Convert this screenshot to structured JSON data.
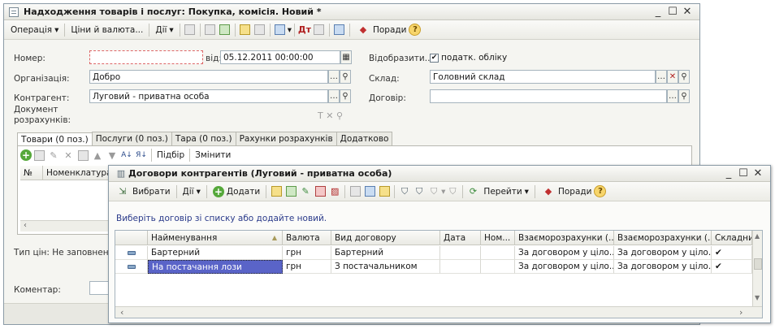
{
  "main_window": {
    "title": "Надходження товарів і послуг: Покупка, комісія. Новий *",
    "controls": [
      "_",
      "☐",
      "✕"
    ],
    "toolbar": {
      "operation": "Операція",
      "prices": "Ціни й валюта...",
      "actions": "Дії",
      "tips": "Поради"
    },
    "form": {
      "number_label": "Номер:",
      "number_value": "",
      "date_label": "від:",
      "date_value": "05.12.2011 00:00:00",
      "display_label": "Відобразити...",
      "tax_checkbox_label": "податк. обліку",
      "tax_checked": true,
      "org_label": "Організація:",
      "org_value": "Добро",
      "warehouse_label": "Склад:",
      "warehouse_value": "Головний склад",
      "contractor_label": "Контрагент:",
      "contractor_value": "Луговий - приватна особа",
      "contract_label": "Договір:",
      "contract_value": "",
      "settlement_doc_label_1": "Документ",
      "settlement_doc_label_2": "розрахунків:",
      "price_type_label": "Тип цін: Не заповнено",
      "comment_label": "Коментар:"
    },
    "tabs": [
      "Товари (0 поз.)",
      "Послуги (0 поз.)",
      "Тара (0 поз.)",
      "Рахунки розрахунків",
      "Додатково"
    ],
    "goods_toolbar": {
      "selection": "Підбір",
      "change": "Змінити"
    },
    "goods_columns": [
      "№",
      "Номенклатура"
    ]
  },
  "dialog": {
    "title": "Договори контрагентів (Луговий - приватна особа)",
    "controls": [
      "_",
      "☐",
      "✕"
    ],
    "toolbar": {
      "select": "Вибрати",
      "actions": "Дії",
      "add": "Додати",
      "go": "Перейти",
      "tips": "Поради"
    },
    "hint": "Виберіть договір зі списку або додайте новий.",
    "columns": [
      "Найменування",
      "Валюта",
      "Вид договору",
      "Дата",
      "Ном...",
      "Взаєморозрахунки (...",
      "Взаєморозрахунки (...",
      "Складни"
    ],
    "rows": [
      {
        "name": "Бартерний",
        "currency": "грн",
        "kind": "Бартерний",
        "date": "",
        "number": "",
        "settle1": "За договором у ціло...",
        "settle2": "За договором у ціло...",
        "complex": "✔"
      },
      {
        "name": "На постачання лози",
        "currency": "грн",
        "kind": "З постачальником",
        "date": "",
        "number": "",
        "settle1": "За договором у ціло...",
        "settle2": "За договором у ціло...",
        "complex": "✔"
      }
    ]
  }
}
